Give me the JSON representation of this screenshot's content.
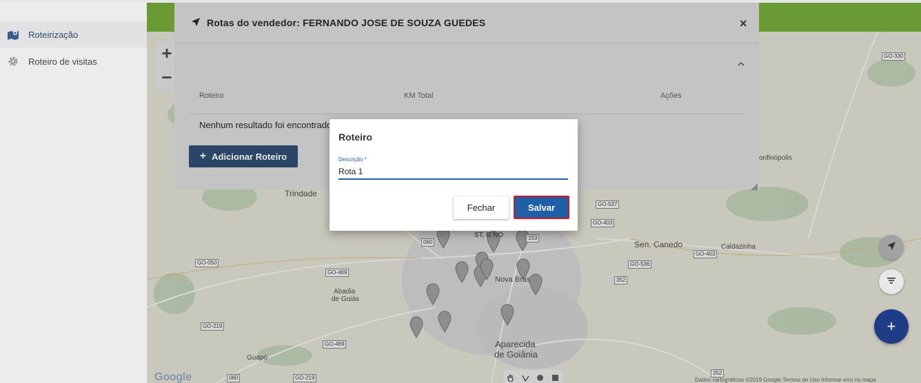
{
  "sidebar": {
    "items": [
      {
        "label": "Roteirização",
        "icon": "map-marker-icon"
      },
      {
        "label": "Roteiro de visitas",
        "icon": "gear-icon"
      }
    ]
  },
  "map": {
    "zoom_in": "+",
    "zoom_out": "−",
    "places": {
      "trindade": "Trindade",
      "st_bueno": "ST. B  NO",
      "nova_brasil": "Nova Bras",
      "sen_canedo": "Sen. Canedo",
      "caldazinha": "Caldazinha",
      "bonfinopolis": "onfinópolis",
      "abadia_1": "Abadia",
      "abadia_2": "de Goiás",
      "aparecida_1": "Aparecida",
      "aparecida_2": "de Goiânia",
      "guapo": "Guapó"
    },
    "roads": {
      "go330": "GO-330",
      "go537": "GO-537",
      "go403a": "GO-403",
      "go403b": "GO-403",
      "go536": "GO-536",
      "go050": "GO-050",
      "go469a": "GO-469",
      "go469b": "GO-469",
      "go219a": "GO-219",
      "go219b": "GO-219",
      "r060a": "060",
      "r060b": "060",
      "r153": "153",
      "r352a": "352",
      "r352b": "352"
    },
    "google": "Google",
    "attribution": "Dados cartográficos ©2019 Google    Termos de Uso    Informar erro no mapa",
    "fab_add": "+"
  },
  "routes_modal": {
    "title": "Rotas do vendedor: FERNANDO JOSE DE SOUZA GUEDES",
    "close": "×",
    "columns": [
      "Roteiro",
      "KM Total",
      "Ações"
    ],
    "empty_text": "Nenhum resultado foi encontrado",
    "add_button": "Adicionar Roteiro",
    "add_plus": "+"
  },
  "dialog": {
    "title": "Roteiro",
    "field_label": "Descrição *",
    "field_value": "Rota 1",
    "close_button": "Fechar",
    "save_button": "Salvar"
  }
}
